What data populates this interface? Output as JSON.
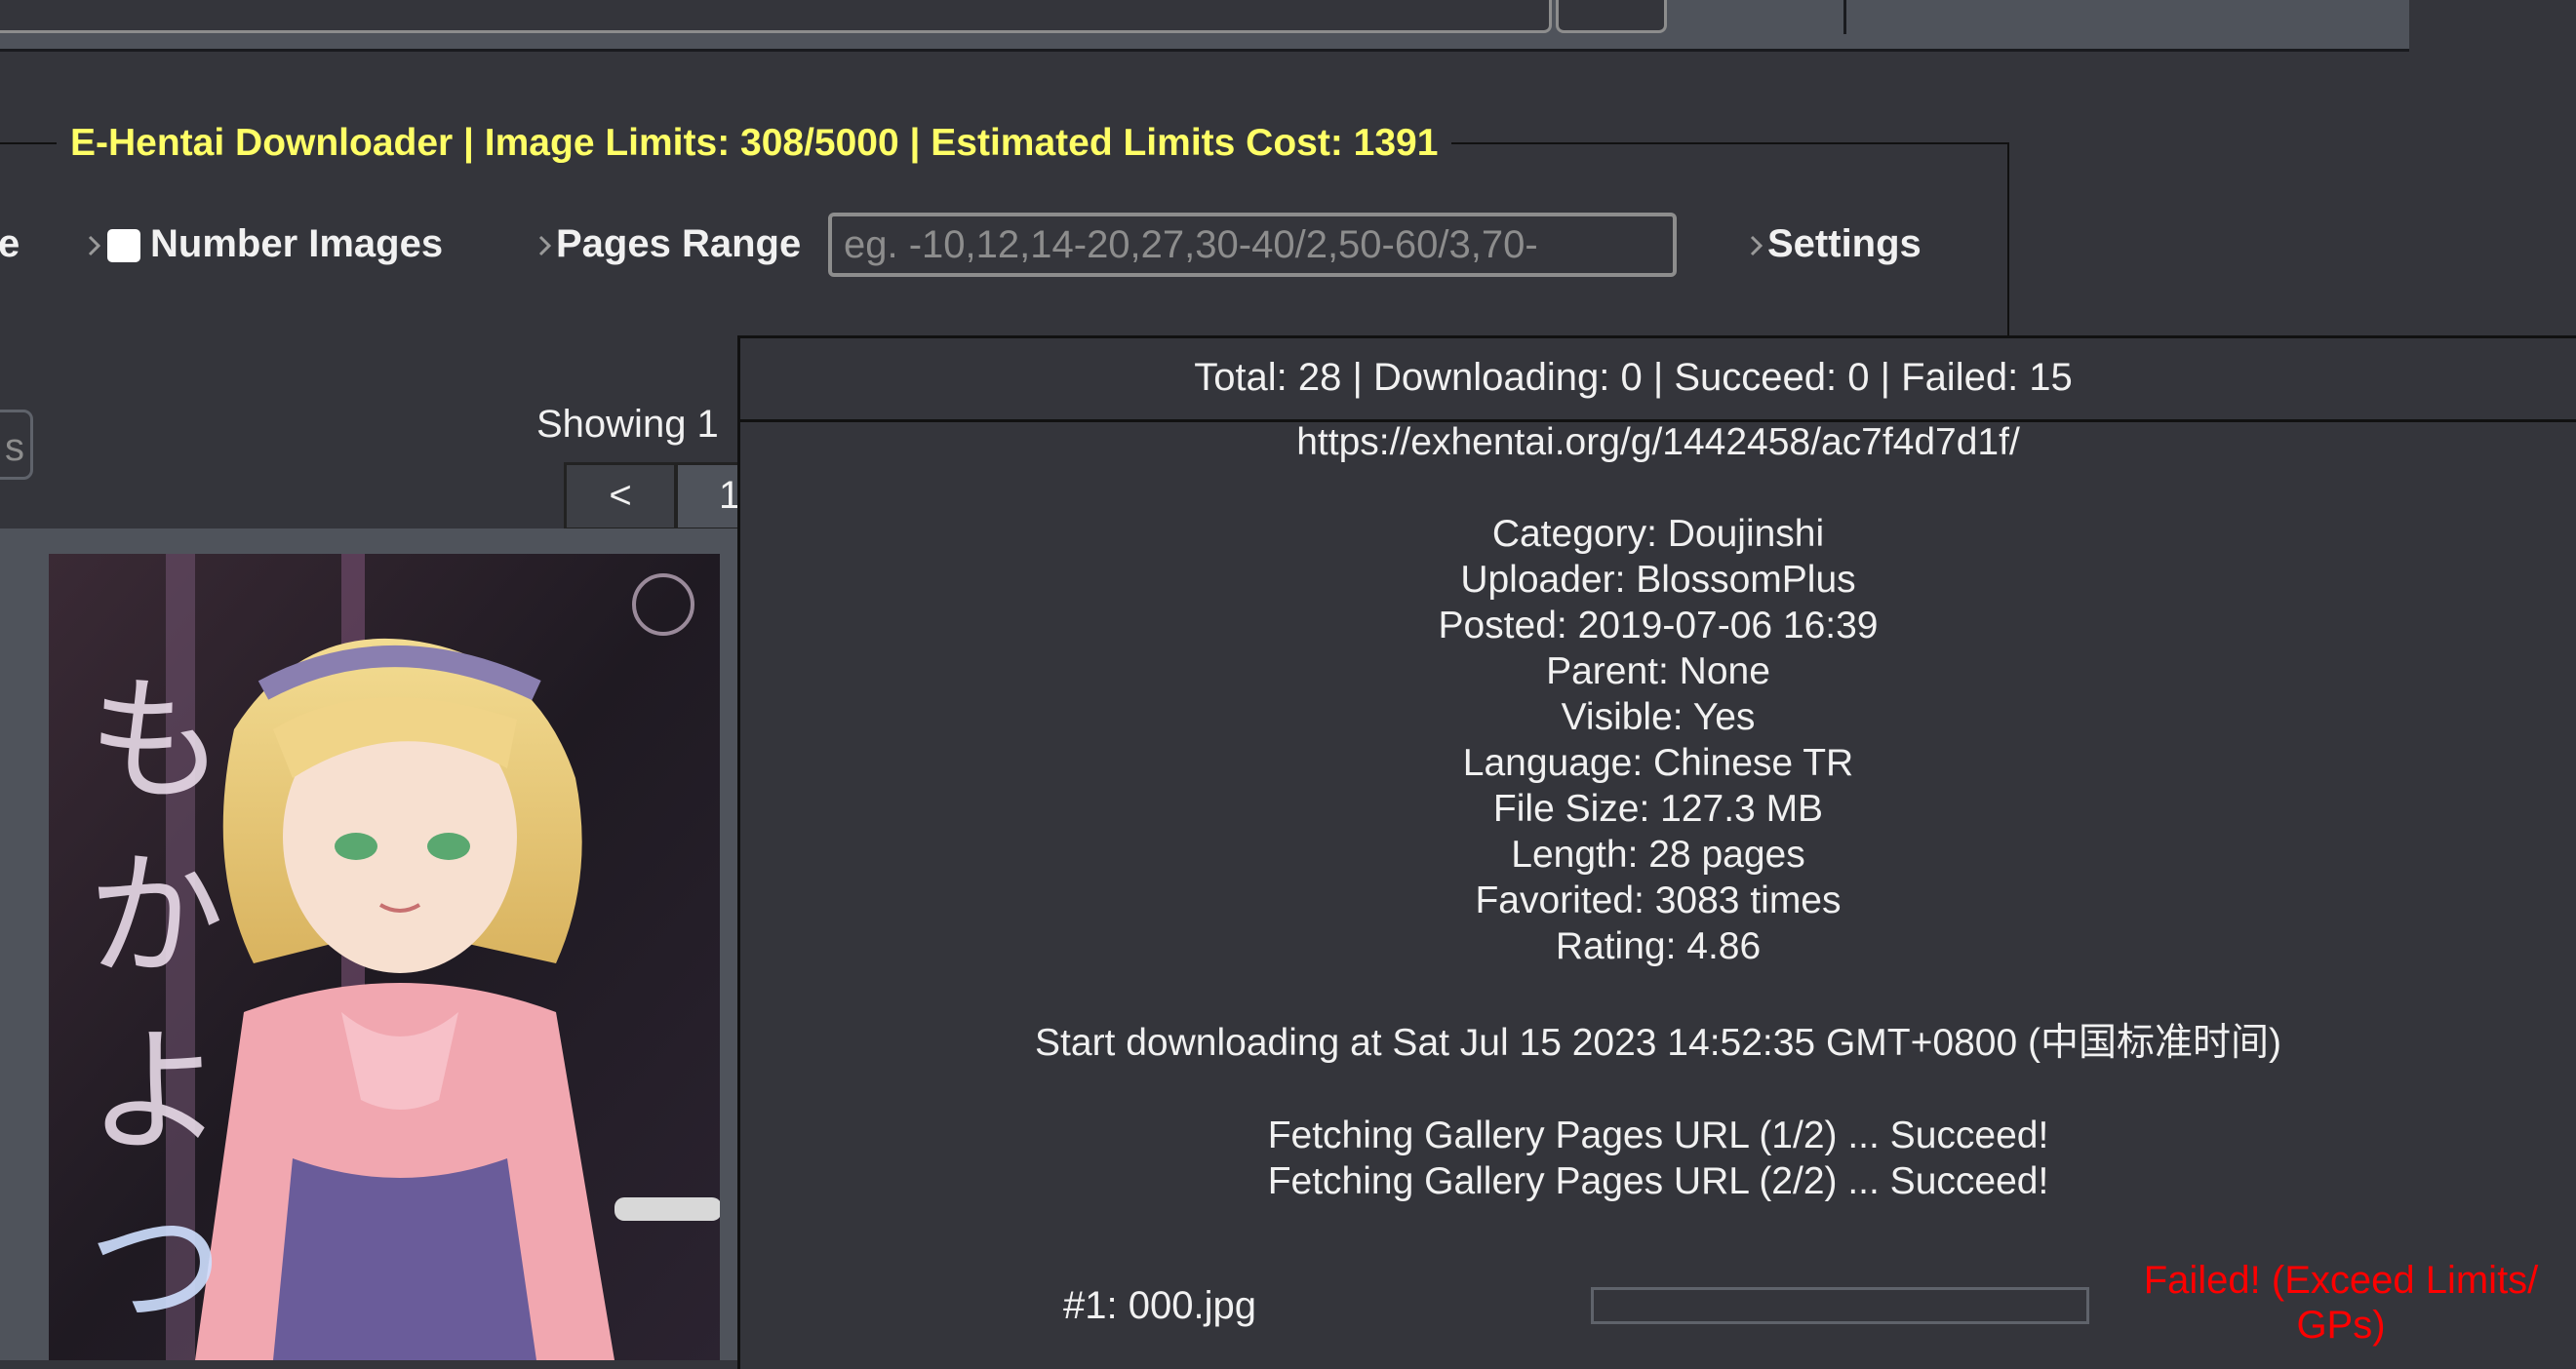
{
  "downloader": {
    "title": "E-Hentai Downloader | Image Limits: 308/5000 | Estimated Limits Cost: 1391",
    "left_partial": "e",
    "number_images_label": "Number Images",
    "pages_range_label": "Pages Range",
    "pages_range_placeholder": "eg. -10,12,14-20,27,30-40/2,50-60/3,70-",
    "settings_label": "Settings"
  },
  "gallery": {
    "left_button_partial": "s",
    "showing_text": "Showing 1",
    "pager_prev": "<",
    "pager_page": "1"
  },
  "progress": {
    "summary": "Total: 28 | Downloading: 0 | Succeed: 0 | Failed: 15",
    "url": "https://exhentai.org/g/1442458/ac7f4d7d1f/",
    "info": [
      "Category: Doujinshi",
      "Uploader: BlossomPlus",
      "Posted: 2019-07-06 16:39",
      "Parent: None",
      "Visible: Yes",
      "Language: Chinese  TR",
      "File Size: 127.3 MB",
      "Length: 28 pages",
      "Favorited: 3083 times",
      "Rating: 4.86"
    ],
    "start_text": "Start downloading at Sat Jul 15 2023 14:52:35 GMT+0800 (中国标准时间)",
    "fetch_1": "Fetching Gallery Pages URL (1/2) ... Succeed!",
    "fetch_2": "Fetching Gallery Pages URL (2/2) ... Succeed!",
    "file_name": "#1: 000.jpg",
    "file_progress": 0,
    "file_status": "Failed! (Exceed Limits/ GPs)"
  },
  "colors": {
    "background": "#34353b",
    "title_yellow": "#ffff66",
    "failed_red": "#ff0000"
  },
  "icons": {
    "option_prefix": "chevron-right-icon"
  }
}
